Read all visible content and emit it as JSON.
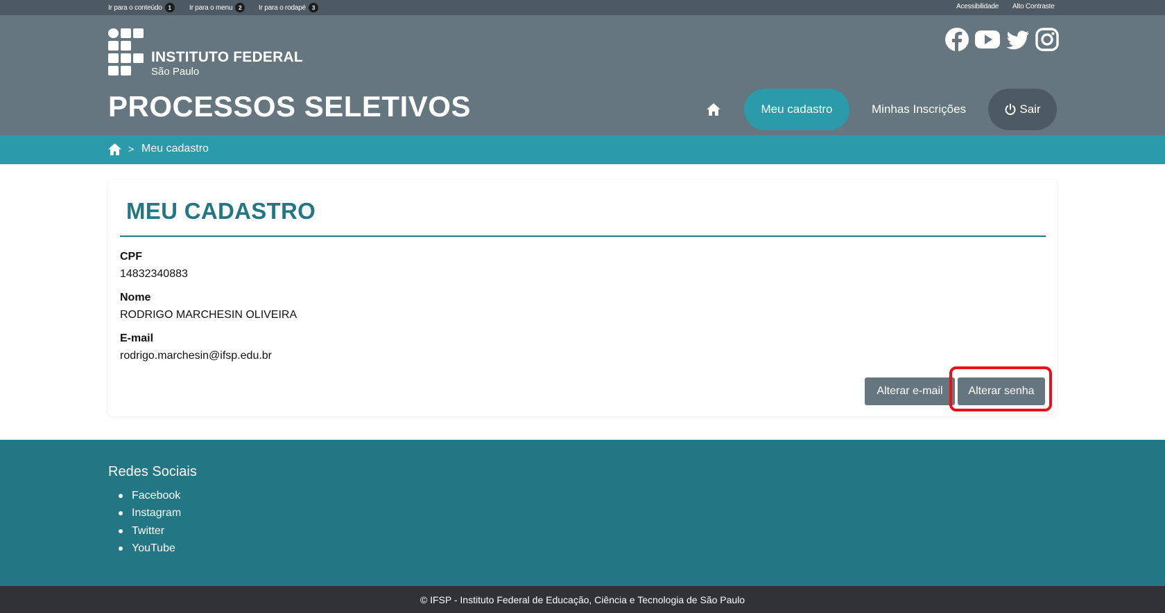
{
  "topbar": {
    "skip_content": "Ir para o conteúdo",
    "skip_content_key": "1",
    "skip_menu": "Ir para o menu",
    "skip_menu_key": "2",
    "skip_footer": "Ir para o rodapé",
    "skip_footer_key": "3",
    "accessibility": "Acessibilidade",
    "high_contrast": "Alto Contraste"
  },
  "header": {
    "logo_title": "INSTITUTO FEDERAL",
    "logo_subtitle": "São Paulo",
    "site_title": "PROCESSOS SELETIVOS",
    "social_icons": [
      "facebook-icon",
      "youtube-icon",
      "twitter-icon",
      "instagram-icon"
    ]
  },
  "nav": {
    "home_icon": "home-icon",
    "my_register": "Meu cadastro",
    "my_applications": "Minhas Inscrições",
    "logout": "Sair"
  },
  "breadcrumb": {
    "separator": ">",
    "current": "Meu cadastro"
  },
  "profile": {
    "title": "MEU CADASTRO",
    "cpf_label": "CPF",
    "cpf_value": "14832340883",
    "name_label": "Nome",
    "name_value": "RODRIGO MARCHESIN OLIVEIRA",
    "email_label": "E-mail",
    "email_value": "rodrigo.marchesin@ifsp.edu.br",
    "change_email_button": "Alterar e-mail",
    "change_password_button": "Alterar senha"
  },
  "footer": {
    "social_title": "Redes Sociais",
    "links": [
      "Facebook",
      "Instagram",
      "Twitter",
      "YouTube"
    ],
    "copyright": "© IFSP - Instituto Federal de Educação, Ciência e Tecnologia de São Paulo"
  },
  "colors": {
    "header_bg": "#66767f",
    "topbar_bg": "#4e5a63",
    "accent": "#2b9aaa",
    "footer_bg": "#237684",
    "highlight": "#e8111b"
  }
}
